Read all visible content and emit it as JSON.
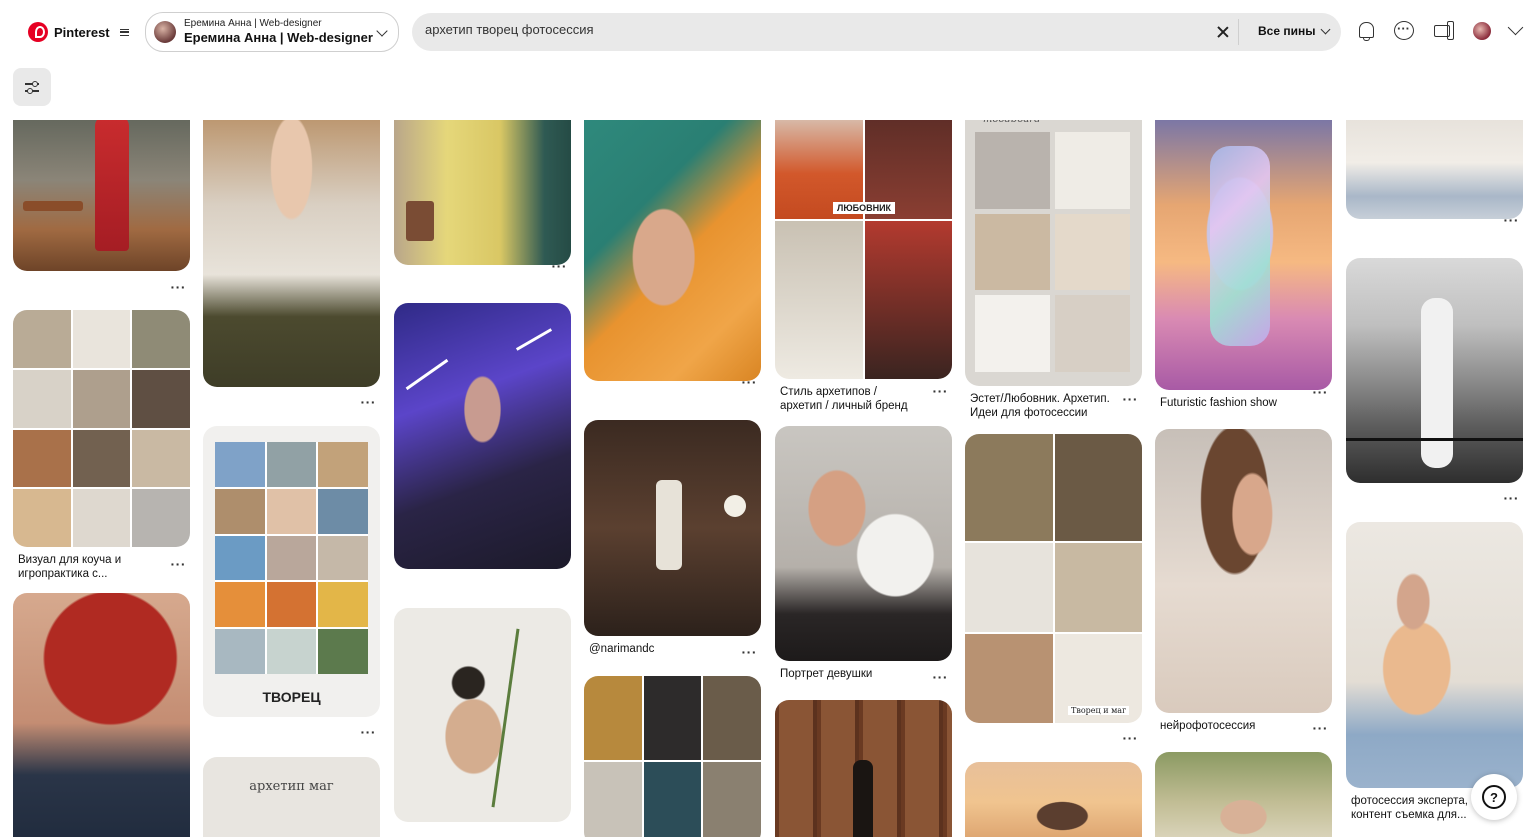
{
  "header": {
    "brand": "Pinterest",
    "profile_small": "Еремина Анна | Web-designer",
    "profile_name": "Еремина Анна | Web-designer",
    "search_value": "архетип творец фотосессия",
    "filter_label": "Все пины"
  },
  "icons": {
    "menu": "menu-icon",
    "clear": "close-icon",
    "bell": "bell-icon",
    "messages": "chat-icon",
    "updates": "megaphone-icon",
    "filters": "sliders-icon",
    "help": "help-icon"
  },
  "more_label": "···",
  "pins": {
    "c1p2_title": "Визуал для коуча и игропрактика с...",
    "c5p1_overlay": "ЛЮБОВНИК",
    "c5p1_title": "Стиль архетипов / архетип / личный бренд",
    "c5p2_title": "Портрет девушки",
    "c6p1_title": "Эстет/Любовник. Архетип. Идеи для фотосессии",
    "c6p1_overlay": "moodboard",
    "c6p2_overlay": "Творец и маг",
    "c7p1_title": "Futuristic fashion show",
    "c7p2_title": "нейрофотосессия",
    "c8p3_title": "фотосессия эксперта, контент съемка для...",
    "c4p2_title": "@narimandc",
    "c2p2_overlay": "ТВОРЕЦ",
    "c2p3_overlay": "архетип маг"
  },
  "help_label": "?",
  "colors": {
    "brand": "#e60023",
    "search_bg": "#e9e9e9"
  }
}
